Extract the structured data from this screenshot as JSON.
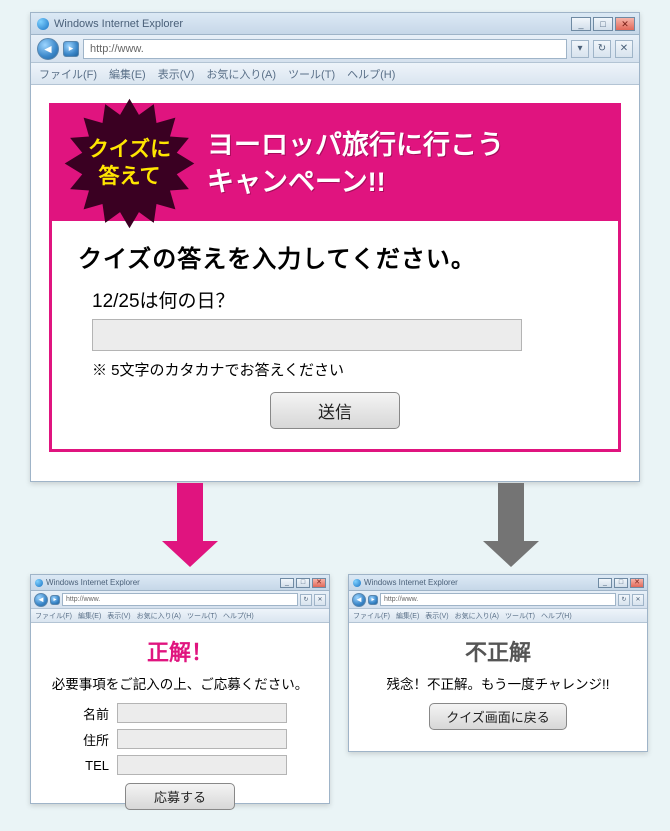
{
  "chrome": {
    "window_title": "Windows Internet Explorer",
    "url": "http://www.",
    "menus": {
      "file": "ファイル(F)",
      "edit": "編集(E)",
      "view": "表示(V)",
      "favorites": "お気に入り(A)",
      "tools": "ツール(T)",
      "help": "ヘルプ(H)"
    }
  },
  "campaign": {
    "badge_line1": "クイズに",
    "badge_line2": "答えて",
    "title_line1": "ヨーロッパ旅行に行こう",
    "title_line2": "キャンペーン!!"
  },
  "quiz": {
    "heading": "クイズの答えを入力してください。",
    "question": "12/25は何の日？",
    "hint": "※ 5文字のカタカナでお答えください",
    "submit": "送信"
  },
  "correct": {
    "title": "正解！",
    "subtitle": "必要事項をご記入の上、ご応募ください。",
    "fields": {
      "name": "名前",
      "address": "住所",
      "tel": "TEL"
    },
    "button": "応募する"
  },
  "wrong": {
    "title": "不正解",
    "subtitle": "残念！不正解。もう一度チャレンジ!!",
    "button": "クイズ画面に戻る"
  }
}
